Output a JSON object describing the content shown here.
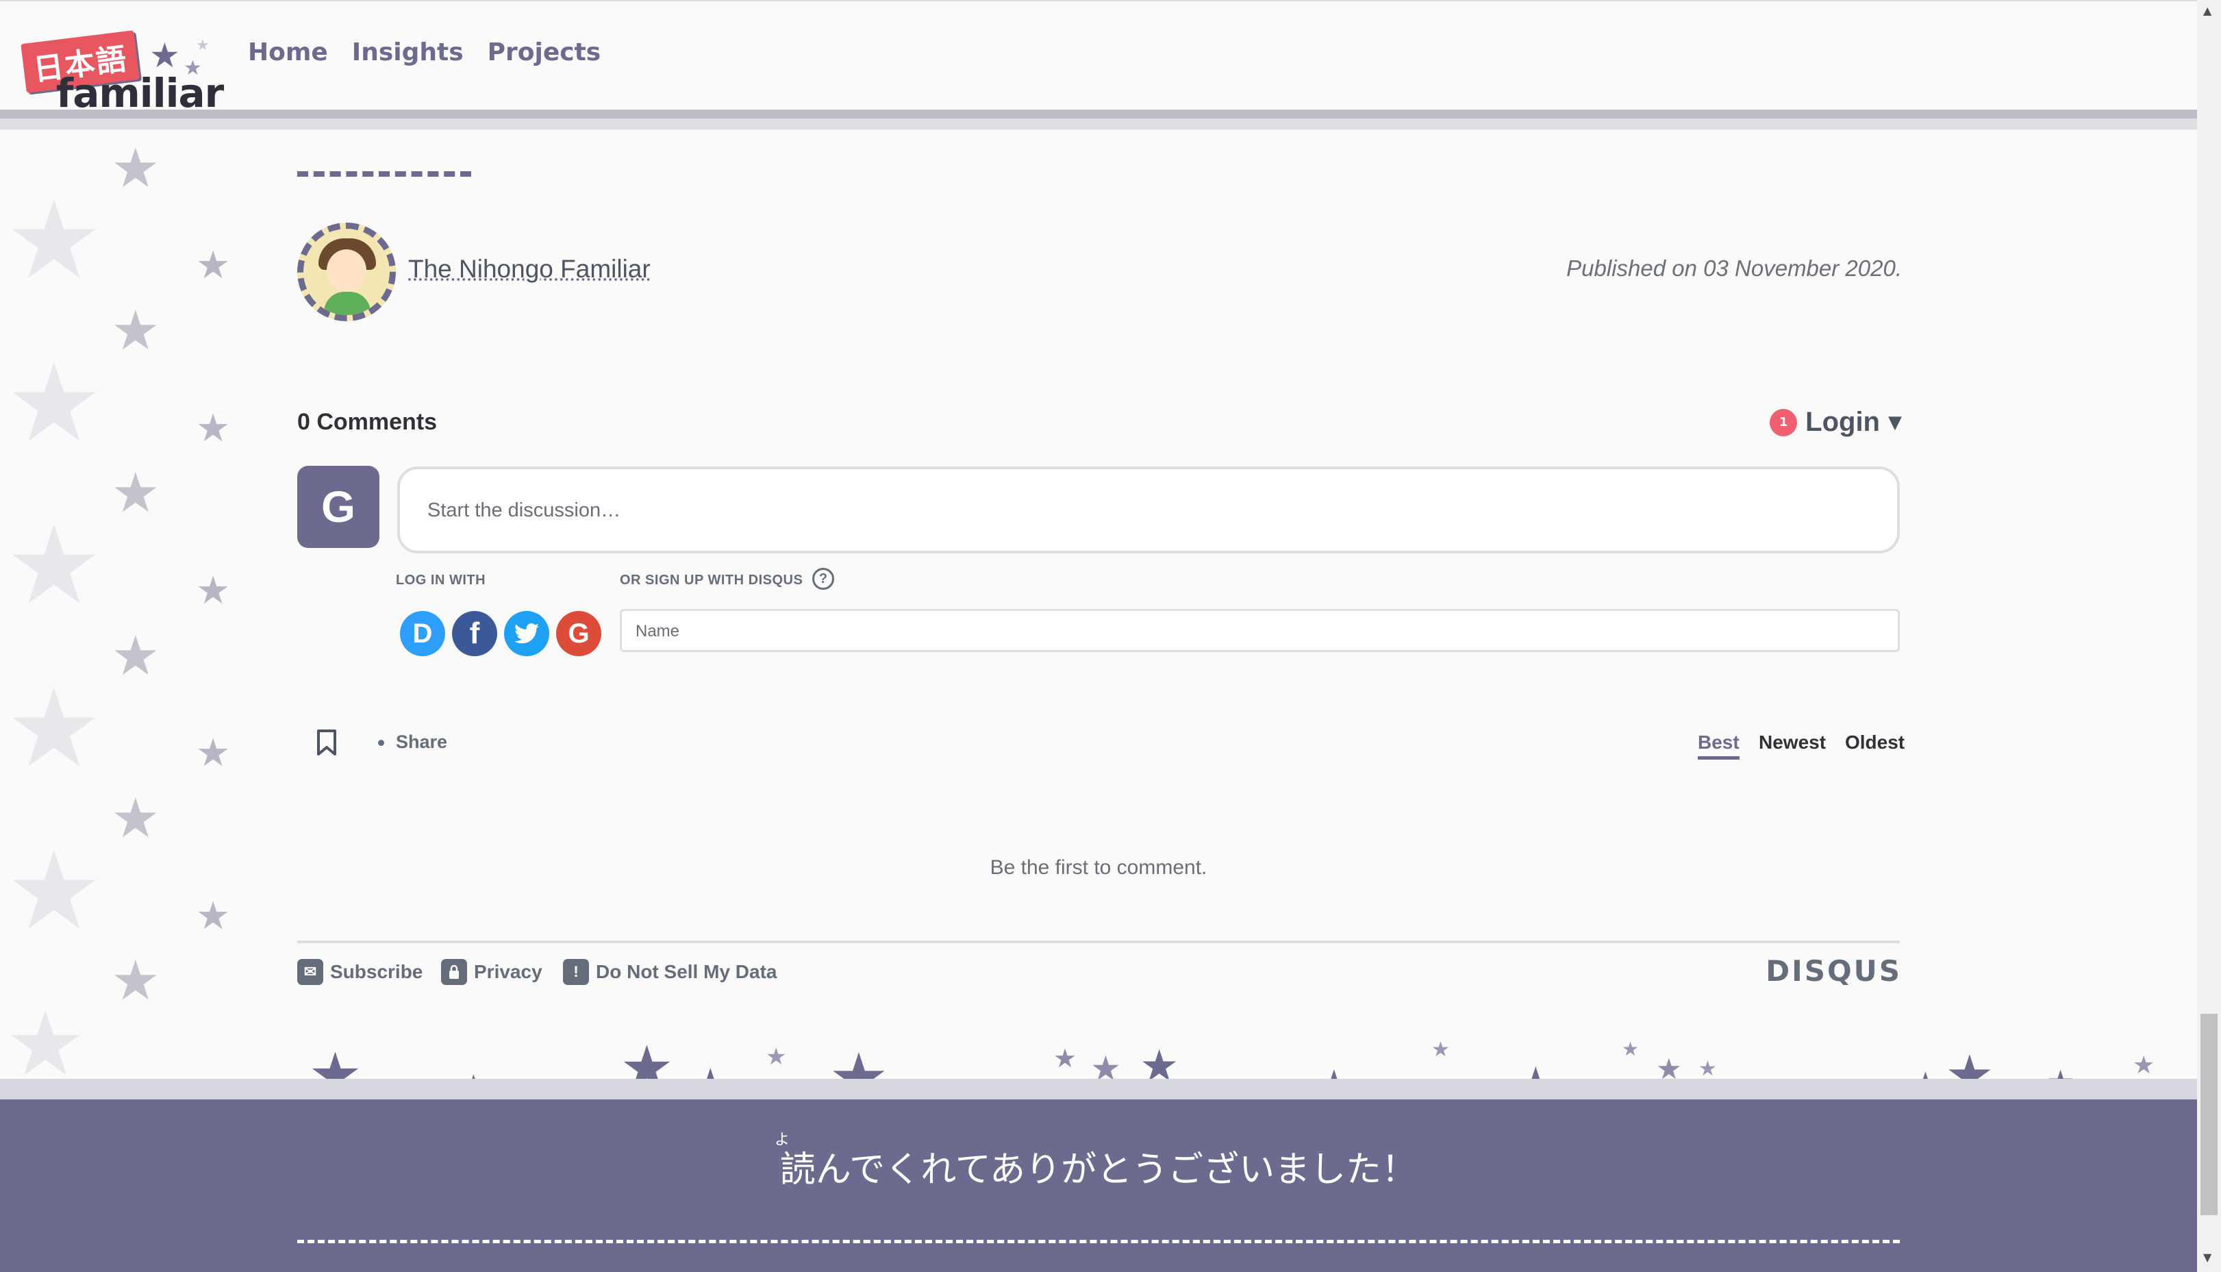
{
  "logo": {
    "jp": "日本語",
    "en": "familiar"
  },
  "nav": [
    "Home",
    "Insights",
    "Projects"
  ],
  "article": {
    "author": "The Nihongo Familiar",
    "published": "Published on 03 November 2020."
  },
  "disqus": {
    "comments_count": "0 Comments",
    "notification_count": "1",
    "login": "Login",
    "avatar_letter": "G",
    "placeholder": "Start the discussion…",
    "log_in_with": "LOG IN WITH",
    "or_sign_up": "OR SIGN UP WITH DISQUS",
    "help": "?",
    "social": [
      "D",
      "f",
      "t",
      "G"
    ],
    "name_placeholder": "Name",
    "share": "Share",
    "sort": [
      "Best",
      "Newest",
      "Oldest"
    ],
    "empty": "Be the first to comment.",
    "footer": {
      "subscribe": "Subscribe",
      "privacy": "Privacy",
      "do_not_sell": "Do Not Sell My Data"
    },
    "brand": "DISQUS"
  },
  "footer": {
    "ruby": "よ",
    "thanks": "読んでくれてありがとうございました！"
  },
  "colors": {
    "accent": "#6c6a8e",
    "badge": "#f05f70",
    "background": "#fafafa"
  }
}
